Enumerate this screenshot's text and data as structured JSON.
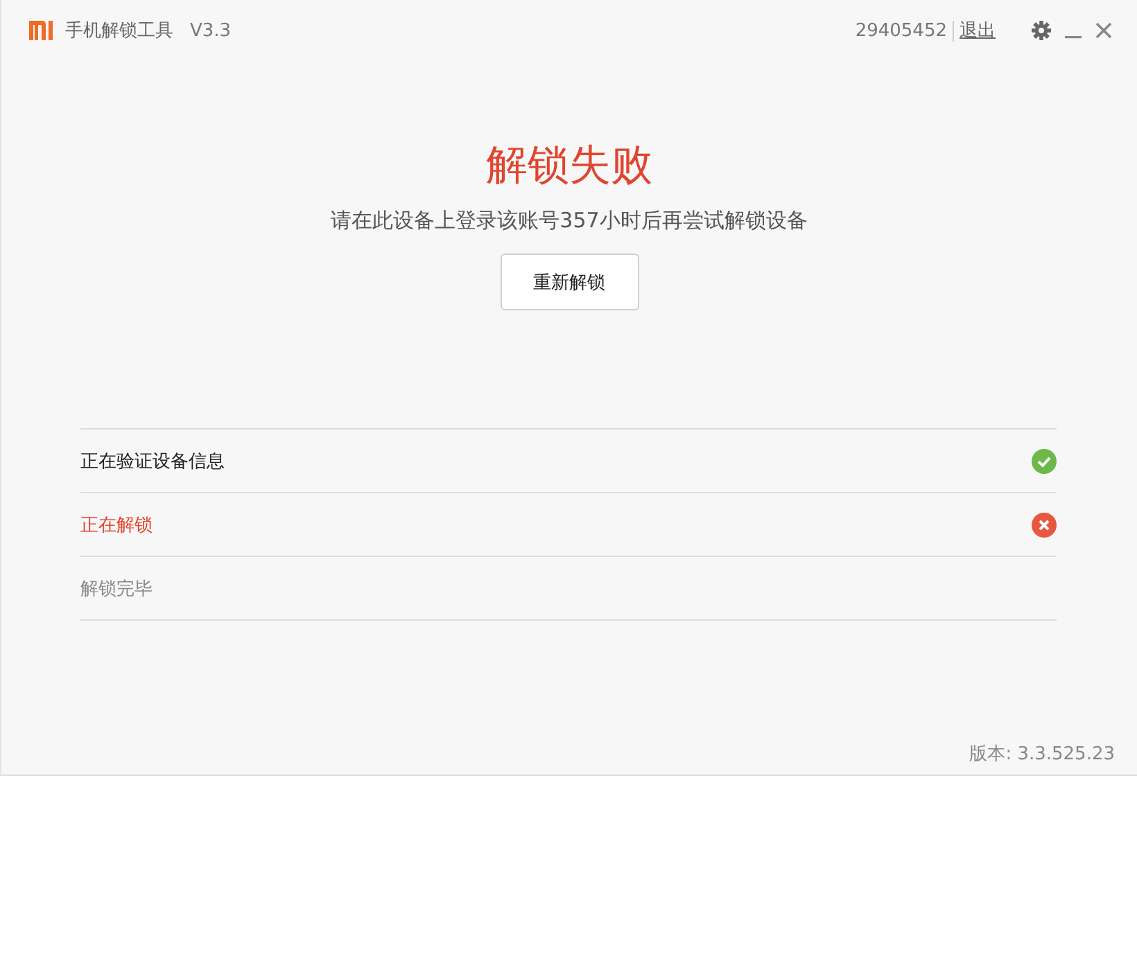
{
  "window": {
    "title": "手机解锁工具",
    "version": "V3.3"
  },
  "account": {
    "id": "29405452",
    "logout": "退出"
  },
  "result": {
    "title": "解锁失败",
    "message": "请在此设备上登录该账号357小时后再尝试解锁设备",
    "button": "重新解锁"
  },
  "steps": [
    {
      "label": "正在验证设备信息",
      "kind": "done"
    },
    {
      "label": "正在解锁",
      "kind": "failed"
    },
    {
      "label": "解锁完毕",
      "kind": "pending"
    }
  ],
  "status_bar": {
    "version": "版本: 3.3.525.23"
  }
}
